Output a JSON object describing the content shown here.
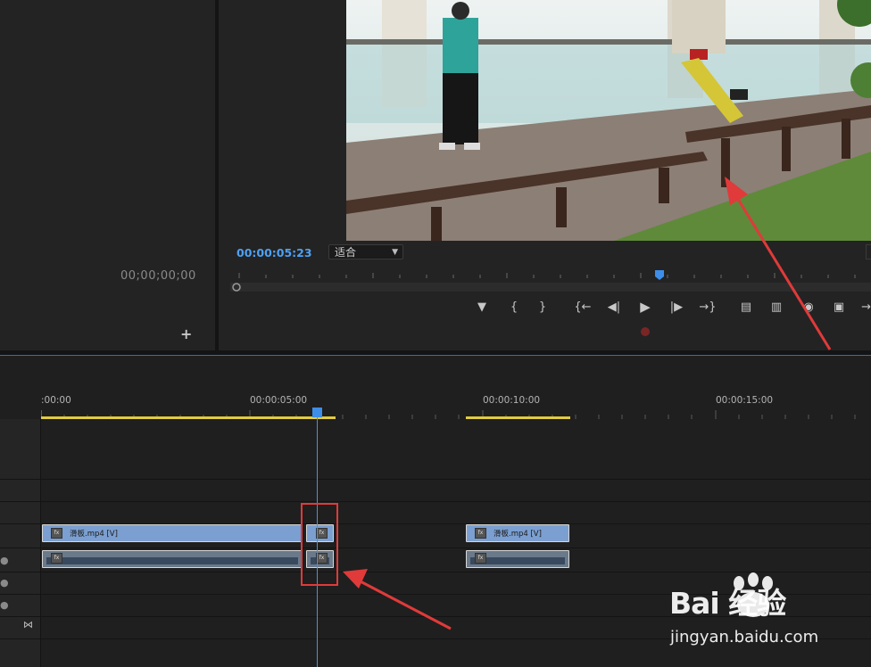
{
  "source_monitor": {
    "timecode": "00;00;00;00",
    "add_label": "+"
  },
  "program_monitor": {
    "timecode": "00:00:05:23",
    "fit_value": "适合",
    "controls": [
      "marker-icon",
      "mark-in-icon",
      "mark-out-icon",
      "go-to-in-icon",
      "step-back-icon",
      "play-icon",
      "step-forward-icon",
      "go-to-out-icon",
      "lift-icon",
      "extract-icon",
      "export-frame-icon",
      "compare-icon",
      "more-icon"
    ]
  },
  "timeline": {
    "ruler_labels": [
      ":00:00",
      "00:00:05:00",
      "00:00:10:00",
      "00:00:15:00"
    ],
    "clips": [
      {
        "track": "V1",
        "name": "滑板.mp4 [V]"
      },
      {
        "track": "V1",
        "name": ""
      },
      {
        "track": "V1",
        "name": "滑板.mp4 [V]"
      },
      {
        "track": "A1",
        "name": ""
      },
      {
        "track": "A1",
        "name": ""
      },
      {
        "track": "A1",
        "name": ""
      }
    ]
  },
  "watermark": {
    "brand": "Bai 经验",
    "url": "jingyan.baidu.com"
  },
  "colors": {
    "accent": "#4ea1f5",
    "workarea": "#e3cc3e",
    "video_clip": "#7b9fd0",
    "highlight": "#e03a3a"
  }
}
